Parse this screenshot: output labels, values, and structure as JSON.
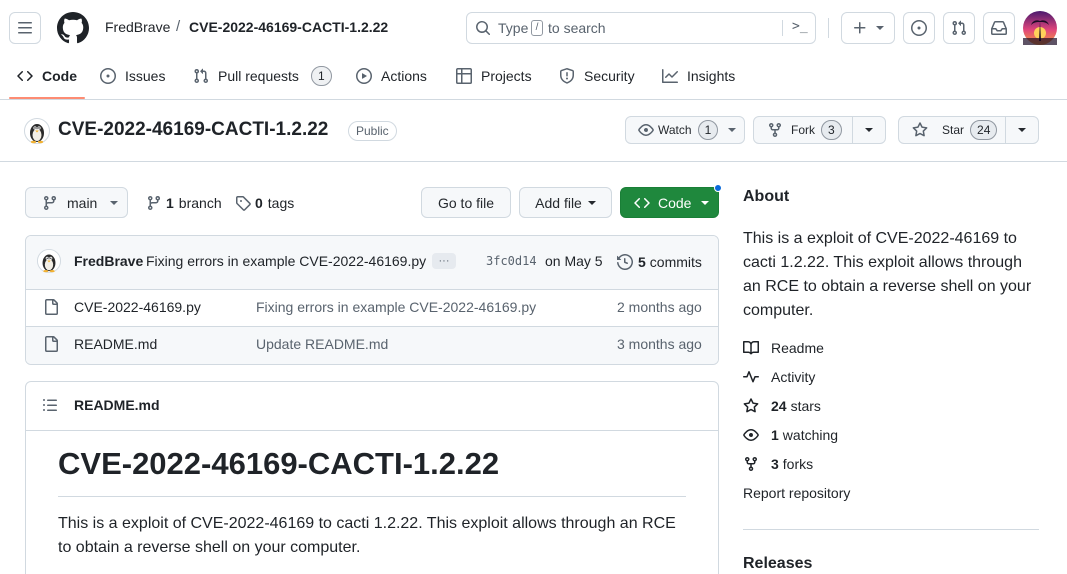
{
  "header": {
    "owner": "FredBrave",
    "separator": "/",
    "repo_name": "CVE-2022-46169-CACTI-1.2.22",
    "search_placeholder_prefix": "Type",
    "search_key": "/",
    "search_placeholder_suffix": "to search",
    "command_glyph": ">_"
  },
  "nav": {
    "tabs": [
      {
        "label": "Code"
      },
      {
        "label": "Issues"
      },
      {
        "label": "Pull requests",
        "count": "1"
      },
      {
        "label": "Actions"
      },
      {
        "label": "Projects"
      },
      {
        "label": "Security"
      },
      {
        "label": "Insights"
      }
    ]
  },
  "repo_header": {
    "title": "CVE-2022-46169-CACTI-1.2.22",
    "visibility": "Public",
    "watch_label": "Watch",
    "watch_count": "1",
    "fork_label": "Fork",
    "fork_count": "3",
    "star_label": "Star",
    "star_count": "24"
  },
  "toolbar": {
    "branch": "main",
    "branch_count": "1",
    "branch_word": "branch",
    "tag_count": "0",
    "tag_word": "tags",
    "go_to_file": "Go to file",
    "add_file": "Add file",
    "code": "Code"
  },
  "commit_bar": {
    "author": "FredBrave",
    "message": "Fixing errors in example CVE-2022-46169.py",
    "ellipsis": "···",
    "sha": "3fc0d14",
    "date": "on May 5",
    "commits_count": "5",
    "commits_word": "commits"
  },
  "files": [
    {
      "name": "CVE-2022-46169.py",
      "message": "Fixing errors in example CVE-2022-46169.py",
      "age": "2 months ago"
    },
    {
      "name": "README.md",
      "message": "Update README.md",
      "age": "3 months ago"
    }
  ],
  "readme": {
    "header": "README.md",
    "title": "CVE-2022-46169-CACTI-1.2.22",
    "body": "This is a exploit of CVE-2022-46169 to cacti 1.2.22. This exploit allows through an RCE to obtain a reverse shell on your computer."
  },
  "about": {
    "heading": "About",
    "description": "This is a exploit of CVE-2022-46169 to cacti 1.2.22. This exploit allows through an RCE to obtain a reverse shell on your computer.",
    "readme": "Readme",
    "activity": "Activity",
    "stars_count": "24",
    "stars_word": "stars",
    "watching_count": "1",
    "watching_word": "watching",
    "forks_count": "3",
    "forks_word": "forks",
    "report": "Report repository",
    "releases": "Releases"
  },
  "colors": {
    "accent_underline": "#fd8c73",
    "code_button": "#1f883d",
    "link_blue": "#0969da"
  },
  "icons": [
    "hamburger-icon",
    "github-logo-icon",
    "search-icon",
    "terminal-icon",
    "plus-icon",
    "issue-icon",
    "pull-request-icon",
    "inbox-icon",
    "code-icon",
    "play-icon",
    "table-icon",
    "shield-icon",
    "graph-icon",
    "eye-icon",
    "fork-icon",
    "star-icon",
    "branch-icon",
    "tag-icon",
    "history-icon",
    "file-icon",
    "list-icon",
    "book-icon",
    "pulse-icon"
  ]
}
